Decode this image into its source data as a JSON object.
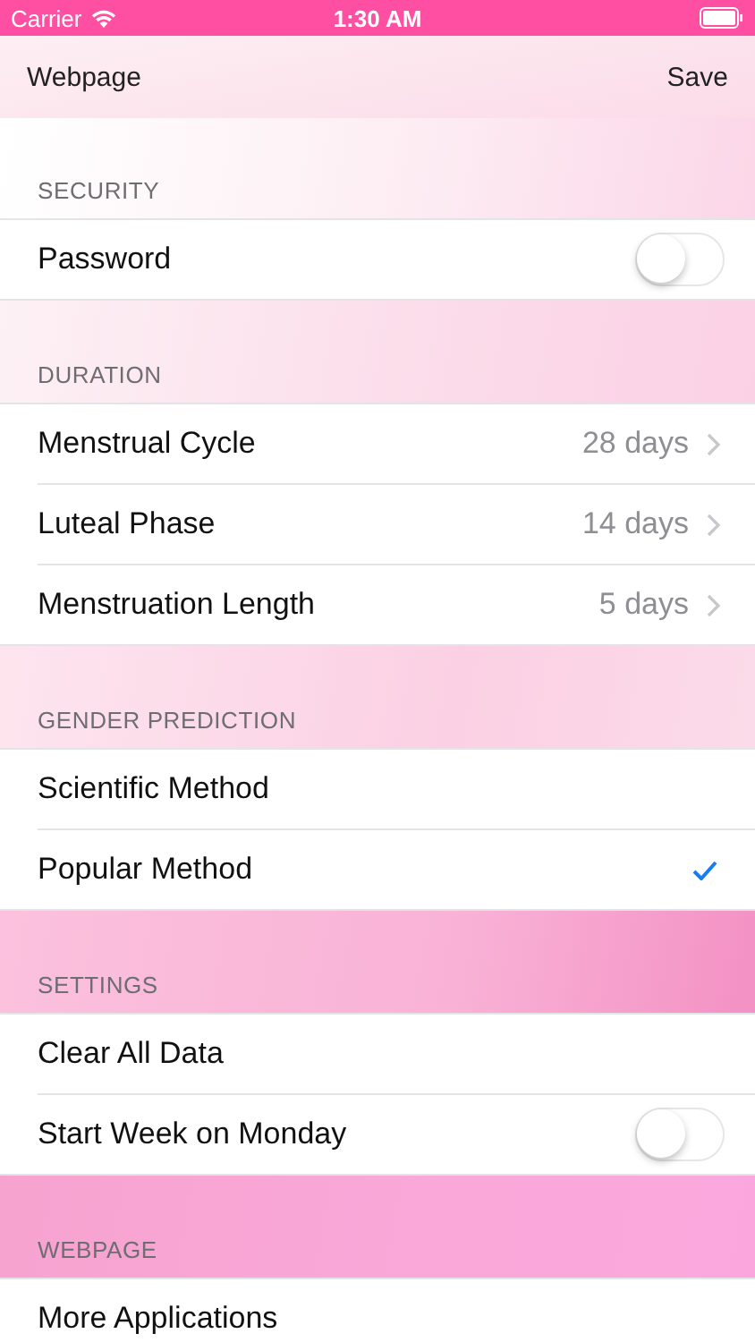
{
  "status_bar": {
    "carrier": "Carrier",
    "time": "1:30 AM"
  },
  "nav": {
    "left": "Webpage",
    "right": "Save"
  },
  "sections": [
    {
      "title": "SECURITY",
      "rows": [
        {
          "kind": "toggle",
          "label": "Password",
          "on": false
        }
      ]
    },
    {
      "title": "DURATION",
      "rows": [
        {
          "kind": "value",
          "label": "Menstrual Cycle",
          "value": "28 days"
        },
        {
          "kind": "value",
          "label": "Luteal Phase",
          "value": "14 days"
        },
        {
          "kind": "value",
          "label": "Menstruation Length",
          "value": "5 days"
        }
      ]
    },
    {
      "title": "GENDER PREDICTION",
      "rows": [
        {
          "kind": "check",
          "label": "Scientific Method",
          "selected": false
        },
        {
          "kind": "check",
          "label": "Popular Method",
          "selected": true
        }
      ]
    },
    {
      "title": "SETTINGS",
      "rows": [
        {
          "kind": "plain",
          "label": "Clear All Data"
        },
        {
          "kind": "toggle",
          "label": "Start Week on Monday",
          "on": false
        }
      ]
    },
    {
      "title": "WEBPAGE",
      "rows": [
        {
          "kind": "plain",
          "label": "More Applications"
        }
      ]
    }
  ]
}
